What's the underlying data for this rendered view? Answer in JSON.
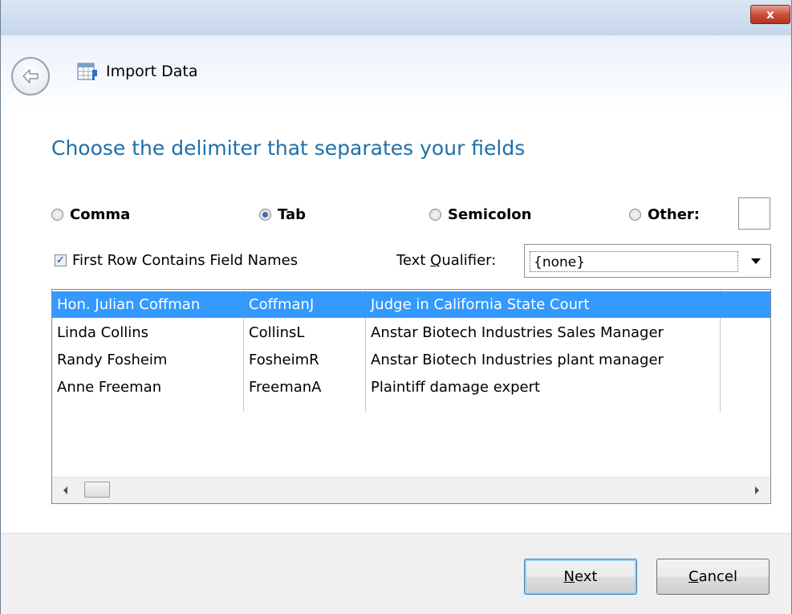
{
  "window": {
    "title": "Import Data",
    "close_glyph": "x"
  },
  "icons": {
    "back": "back-arrow-icon",
    "app": "import-data-icon",
    "close": "close-icon"
  },
  "heading": "Choose the delimiter that separates your fields",
  "delimiters": {
    "comma": {
      "label": "Comma",
      "checked": false
    },
    "tab": {
      "label": "Tab",
      "checked": true
    },
    "semicolon": {
      "label": "Semicolon",
      "checked": false
    },
    "other": {
      "label": "Other:",
      "checked": false,
      "value": ""
    }
  },
  "first_row": {
    "label": "First Row Contains Field Names",
    "checked": true
  },
  "text_qualifier": {
    "label_pre": "Text ",
    "label_u": "Q",
    "label_post": "ualifier:",
    "value": "{none}"
  },
  "preview": {
    "rows": [
      [
        "Hon. Julian Coffman",
        "CoffmanJ",
        "Judge in California State Court"
      ],
      [
        "Linda Collins",
        "CollinsL",
        "Anstar Biotech Industries Sales Manager"
      ],
      [
        "Randy Fosheim",
        "FosheimR",
        "Anstar Biotech Industries plant manager"
      ],
      [
        "Anne Freeman",
        "FreemanA",
        "Plaintiff damage expert"
      ]
    ],
    "selected_row": 0
  },
  "buttons": {
    "next": {
      "u": "N",
      "rest": "ext"
    },
    "cancel": {
      "u": "C",
      "rest": "ancel"
    }
  },
  "colors": {
    "heading": "#1e6fa8",
    "selection": "#3399ff"
  }
}
